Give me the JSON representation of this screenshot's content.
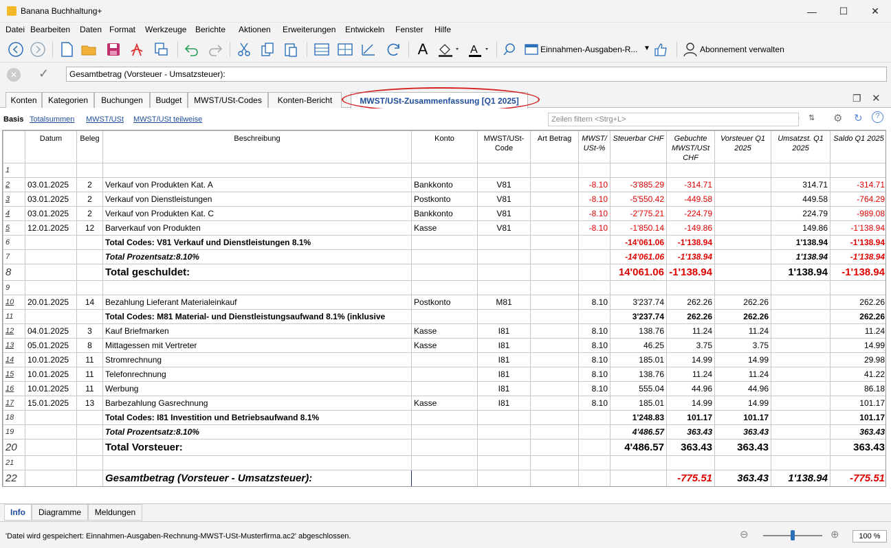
{
  "app": {
    "title": "Banana Buchhaltung+",
    "logo_color": "#f6b82b"
  },
  "window": {
    "min": "—",
    "max": "☐",
    "close": "✕"
  },
  "menu": [
    "Datei",
    "Bearbeiten",
    "Daten",
    "Format",
    "Werkzeuge",
    "Berichte",
    "Aktionen",
    "Erweiterungen",
    "Entwickeln",
    "Fenster",
    "Hilfe"
  ],
  "toolbar": {
    "file_selector": "Einnahmen-Ausgaben-R...",
    "subscription": "Abonnement verwalten",
    "icons": [
      "back-icon",
      "forward-icon",
      "new-file-icon",
      "open-folder-icon",
      "save-icon",
      "pdf-icon",
      "print-preview-icon",
      "undo-icon",
      "redo-icon",
      "cut-icon",
      "copy-icon",
      "paste-icon",
      "add-row-icon",
      "insert-row-icon",
      "edit-icon",
      "refresh-icon",
      "font-icon",
      "fill-color-icon",
      "text-color-icon",
      "search-icon",
      "file-selector-icon",
      "thumbs-up-icon",
      "user-icon"
    ]
  },
  "editbar": {
    "value": "Gesamtbetrag (Vorsteuer - Umsatzsteuer):"
  },
  "tabs": [
    "Konten",
    "Kategorien",
    "Buchungen",
    "Budget",
    "MWST/USt-Codes",
    "Konten-Bericht",
    "MWST/USt-Zusammenfassung [Q1 2025]"
  ],
  "views": {
    "basis": "Basis",
    "links": [
      "Totalsummen",
      "MWST/USt",
      "MWST/USt teilweise"
    ]
  },
  "filter": {
    "placeholder": "Zeilen filtern <Strg+L>"
  },
  "columns": [
    "",
    "Datum",
    "Beleg",
    "Beschreibung",
    "Konto",
    "MWST/USt-Code",
    "Art Betrag",
    "MWST/ USt-%",
    "Steuerbar CHF",
    "Gebuchte MWST/USt CHF",
    "Vorsteuer Q1 2025",
    "Umsatzst. Q1 2025",
    "Saldo Q1 2025"
  ],
  "rows": [
    {
      "n": "1",
      "d": "",
      "b": "",
      "desc": "",
      "k": "",
      "code": "",
      "pct": "",
      "st": "",
      "geb": "",
      "vst": "",
      "ust": "",
      "saldo": "",
      "style": ""
    },
    {
      "n": "2",
      "d": "03.01.2025",
      "b": "2",
      "desc": "Verkauf von Produkten Kat. A",
      "k": "Bankkonto",
      "code": "V81",
      "pct": "-8.10",
      "st": "-3'885.29",
      "geb": "-314.71",
      "vst": "",
      "ust": "314.71",
      "saldo": "-314.71",
      "style": "link"
    },
    {
      "n": "3",
      "d": "03.01.2025",
      "b": "2",
      "desc": "Verkauf von Dienstleistungen",
      "k": "Postkonto",
      "code": "V81",
      "pct": "-8.10",
      "st": "-5'550.42",
      "geb": "-449.58",
      "vst": "",
      "ust": "449.58",
      "saldo": "-764.29",
      "style": "link"
    },
    {
      "n": "4",
      "d": "03.01.2025",
      "b": "2",
      "desc": "Verkauf von Produkten Kat. C",
      "k": "Bankkonto",
      "code": "V81",
      "pct": "-8.10",
      "st": "-2'775.21",
      "geb": "-224.79",
      "vst": "",
      "ust": "224.79",
      "saldo": "-989.08",
      "style": "link"
    },
    {
      "n": "5",
      "d": "12.01.2025",
      "b": "12",
      "desc": "Barverkauf von Produkten",
      "k": "Kasse",
      "code": "V81",
      "pct": "-8.10",
      "st": "-1'850.14",
      "geb": "-149.86",
      "vst": "",
      "ust": "149.86",
      "saldo": "-1'138.94",
      "style": "link"
    },
    {
      "n": "6",
      "d": "",
      "b": "",
      "desc": "Total Codes: V81 Verkauf und Dienstleistungen 8.1%",
      "k": "",
      "code": "",
      "pct": "",
      "st": "-14'061.06",
      "geb": "-1'138.94",
      "vst": "",
      "ust": "1'138.94",
      "saldo": "-1'138.94",
      "style": "bold"
    },
    {
      "n": "7",
      "d": "",
      "b": "",
      "desc": "Total Prozentsatz:8.10%",
      "k": "",
      "code": "",
      "pct": "",
      "st": "-14'061.06",
      "geb": "-1'138.94",
      "vst": "",
      "ust": "1'138.94",
      "saldo": "-1'138.94",
      "style": "bolditalic"
    },
    {
      "n": "8",
      "d": "",
      "b": "",
      "desc": "Total geschuldet:",
      "k": "",
      "code": "",
      "pct": "",
      "st": "14'061.06",
      "geb": "-1'138.94",
      "vst": "",
      "ust": "1'138.94",
      "saldo": "-1'138.94",
      "style": "big",
      "st_red": true
    },
    {
      "n": "9",
      "d": "",
      "b": "",
      "desc": "",
      "k": "",
      "code": "",
      "pct": "",
      "st": "",
      "geb": "",
      "vst": "",
      "ust": "",
      "saldo": "",
      "style": ""
    },
    {
      "n": "10",
      "d": "20.01.2025",
      "b": "14",
      "desc": "Bezahlung Lieferant Materialeinkauf",
      "k": "Postkonto",
      "code": "M81",
      "pct": "8.10",
      "st": "3'237.74",
      "geb": "262.26",
      "vst": "262.26",
      "ust": "",
      "saldo": "262.26",
      "style": "link"
    },
    {
      "n": "11",
      "d": "",
      "b": "",
      "desc": "Total Codes: M81 Material- und Dienstleistungsaufwand 8.1%  (inklusive",
      "k": "",
      "code": "",
      "pct": "",
      "st": "3'237.74",
      "geb": "262.26",
      "vst": "262.26",
      "ust": "",
      "saldo": "262.26",
      "style": "bold"
    },
    {
      "n": "12",
      "d": "04.01.2025",
      "b": "3",
      "desc": "Kauf Briefmarken",
      "k": "Kasse",
      "code": "I81",
      "pct": "8.10",
      "st": "138.76",
      "geb": "11.24",
      "vst": "11.24",
      "ust": "",
      "saldo": "11.24",
      "style": "link"
    },
    {
      "n": "13",
      "d": "05.01.2025",
      "b": "8",
      "desc": "Mittagessen mit Vertreter",
      "k": "Kasse",
      "code": "I81",
      "pct": "8.10",
      "st": "46.25",
      "geb": "3.75",
      "vst": "3.75",
      "ust": "",
      "saldo": "14.99",
      "style": "link"
    },
    {
      "n": "14",
      "d": "10.01.2025",
      "b": "11",
      "desc": "Stromrechnung",
      "k": "",
      "code": "I81",
      "pct": "8.10",
      "st": "185.01",
      "geb": "14.99",
      "vst": "14.99",
      "ust": "",
      "saldo": "29.98",
      "style": "link"
    },
    {
      "n": "15",
      "d": "10.01.2025",
      "b": "11",
      "desc": "Telefonrechnung",
      "k": "",
      "code": "I81",
      "pct": "8.10",
      "st": "138.76",
      "geb": "11.24",
      "vst": "11.24",
      "ust": "",
      "saldo": "41.22",
      "style": "link"
    },
    {
      "n": "16",
      "d": "10.01.2025",
      "b": "11",
      "desc": "Werbung",
      "k": "",
      "code": "I81",
      "pct": "8.10",
      "st": "555.04",
      "geb": "44.96",
      "vst": "44.96",
      "ust": "",
      "saldo": "86.18",
      "style": "link"
    },
    {
      "n": "17",
      "d": "15.01.2025",
      "b": "13",
      "desc": "Barbezahlung Gasrechnung",
      "k": "Kasse",
      "code": "I81",
      "pct": "8.10",
      "st": "185.01",
      "geb": "14.99",
      "vst": "14.99",
      "ust": "",
      "saldo": "101.17",
      "style": "link"
    },
    {
      "n": "18",
      "d": "",
      "b": "",
      "desc": "Total Codes: I81 Investition und Betriebsaufwand 8.1%",
      "k": "",
      "code": "",
      "pct": "",
      "st": "1'248.83",
      "geb": "101.17",
      "vst": "101.17",
      "ust": "",
      "saldo": "101.17",
      "style": "bold"
    },
    {
      "n": "19",
      "d": "",
      "b": "",
      "desc": "Total Prozentsatz:8.10%",
      "k": "",
      "code": "",
      "pct": "",
      "st": "4'486.57",
      "geb": "363.43",
      "vst": "363.43",
      "ust": "",
      "saldo": "363.43",
      "style": "bolditalic"
    },
    {
      "n": "20",
      "d": "",
      "b": "",
      "desc": "Total Vorsteuer:",
      "k": "",
      "code": "",
      "pct": "",
      "st": "4'486.57",
      "geb": "363.43",
      "vst": "363.43",
      "ust": "",
      "saldo": "363.43",
      "style": "big"
    },
    {
      "n": "21",
      "d": "",
      "b": "",
      "desc": "",
      "k": "",
      "code": "",
      "pct": "",
      "st": "",
      "geb": "",
      "vst": "",
      "ust": "",
      "saldo": "",
      "style": ""
    },
    {
      "n": "22",
      "d": "",
      "b": "",
      "desc": "Gesamtbetrag (Vorsteuer - Umsatzsteuer):",
      "k": "",
      "code": "",
      "pct": "",
      "st": "",
      "geb": "-775.51",
      "vst": "363.43",
      "ust": "1'138.94",
      "saldo": "-775.51",
      "style": "bigitalic"
    }
  ],
  "bottom_tabs": [
    "Info",
    "Diagramme",
    "Meldungen"
  ],
  "status": {
    "message": "'Datei wird gespeichert: Einnahmen-Ausgaben-Rechnung-MWST-USt-Musterfirma.ac2' abgeschlossen.",
    "zoom": "100 %"
  },
  "colors": {
    "accent": "#1f4d9b",
    "negative": "#e00000",
    "annotation": "#d42020"
  }
}
